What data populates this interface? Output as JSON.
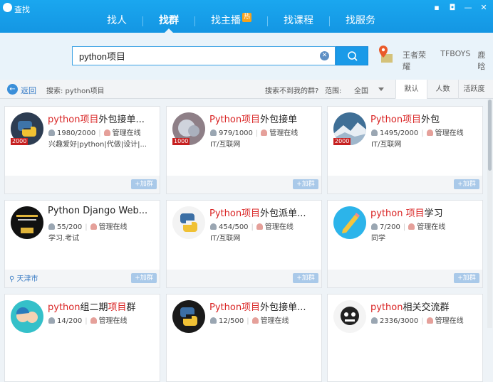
{
  "window": {
    "title": "查找"
  },
  "nav": {
    "items": [
      {
        "label": "找人"
      },
      {
        "label": "找群"
      },
      {
        "label": "找主播",
        "badge": "热"
      },
      {
        "label": "找课程"
      },
      {
        "label": "找服务"
      }
    ]
  },
  "search": {
    "value": "python项目",
    "quick_links": [
      "王者荣耀",
      "TFBOYS",
      "鹿晗"
    ]
  },
  "filter": {
    "back_label": "返回",
    "search_info": "搜索: python项目",
    "not_found": "搜索不到我的群?",
    "range_label": "范围:",
    "range_value": "全国",
    "sort_tabs": [
      "默认",
      "人数",
      "活跃度"
    ]
  },
  "add_label": "+加群",
  "cards": [
    {
      "title_hl": "python项目",
      "title_rest": "外包接单...",
      "members": "1980/2000",
      "admin": "管理在线",
      "tags": "兴趣爱好|python|代做|设计|...",
      "badge": "2000"
    },
    {
      "title_pre": "",
      "title_hl": "Python项目",
      "title_rest": "外包接单",
      "members": "979/1000",
      "admin": "管理在线",
      "tags": "IT/互联网",
      "badge": "1000"
    },
    {
      "title_hl": "Python项目",
      "title_rest": "外包",
      "members": "1495/2000",
      "admin": "管理在线",
      "tags": "IT/互联网",
      "badge": "2000"
    },
    {
      "title_plain": "Python Django Web...",
      "members": "55/200",
      "admin": "管理在线",
      "tags": "学习.考试",
      "location": "天津市"
    },
    {
      "title_hl": "Python项目",
      "title_rest": "外包派单...",
      "members": "454/500",
      "admin": "管理在线",
      "tags": "IT/互联网"
    },
    {
      "title_hl": "python 项目",
      "title_rest": "学习",
      "members": "7/200",
      "admin": "管理在线",
      "tags": "同学"
    },
    {
      "title_hl2": "python",
      "title_mid": "组二期",
      "title_hl": "项目",
      "title_rest": "群",
      "members": "14/200",
      "admin": "管理在线"
    },
    {
      "title_hl": "Python项目",
      "title_rest": "外包接单...",
      "members": "12/500",
      "admin": "管理在线"
    },
    {
      "title_hl": "python",
      "title_rest": "相关交流群",
      "members": "2336/3000",
      "admin": "管理在线"
    }
  ]
}
